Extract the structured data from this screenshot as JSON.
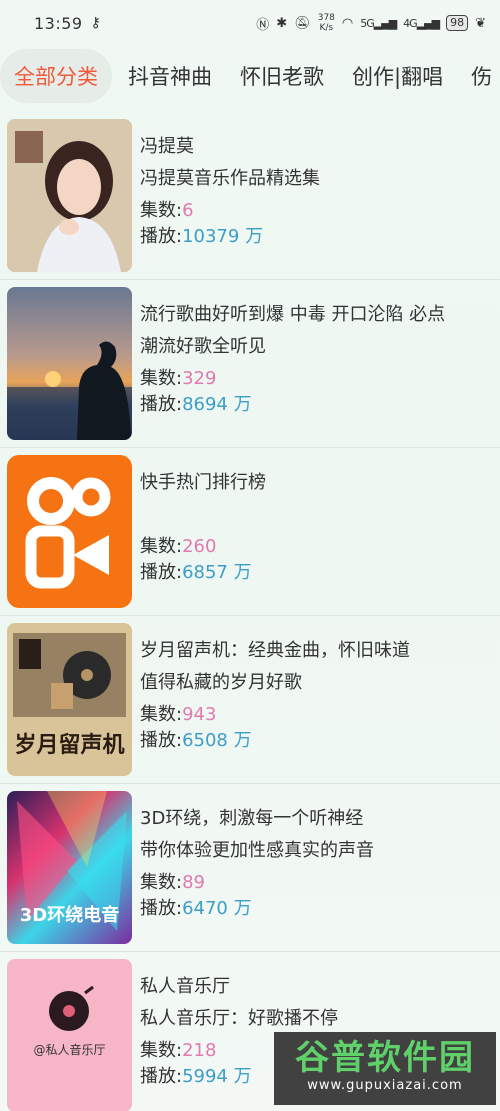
{
  "status": {
    "time": "13:59",
    "net_speed_value": "378",
    "net_speed_unit": "K/s",
    "signal1": "5G",
    "signal2": "4G",
    "battery": "98"
  },
  "tabs": [
    {
      "label": "全部分类",
      "active": true
    },
    {
      "label": "抖音神曲",
      "active": false
    },
    {
      "label": "怀旧老歌",
      "active": false
    },
    {
      "label": "创作|翻唱",
      "active": false
    },
    {
      "label": "伤",
      "active": false
    }
  ],
  "labels": {
    "count_prefix": "集数:",
    "plays_prefix": "播放:",
    "plays_unit": " 万"
  },
  "items": [
    {
      "title": "冯提莫",
      "desc": "冯提莫音乐作品精选集",
      "count": "6",
      "plays": "10379",
      "cover_text": ""
    },
    {
      "title": "流行歌曲好听到爆 中毒 开口沦陷 必点",
      "desc": "潮流好歌全听见",
      "count": "329",
      "plays": "8694",
      "cover_text": ""
    },
    {
      "title": "快手热门排行榜",
      "desc": "",
      "count": "260",
      "plays": "6857",
      "cover_text": ""
    },
    {
      "title": "岁月留声机：经典金曲，怀旧味道",
      "desc": "值得私藏的岁月好歌",
      "count": "943",
      "plays": "6508",
      "cover_text": "岁月留声机"
    },
    {
      "title": "3D环绕，刺激每一个听神经",
      "desc": "带你体验更加性感真实的声音",
      "count": "89",
      "plays": "6470",
      "cover_text": "3D环绕电音"
    },
    {
      "title": "私人音乐厅",
      "desc": "私人音乐厅：好歌播不停",
      "count": "218",
      "plays": "5994",
      "cover_text": "@私人音乐厅"
    }
  ],
  "watermark": {
    "title": "谷普软件园",
    "url": "www.gupuxiazai.com"
  }
}
